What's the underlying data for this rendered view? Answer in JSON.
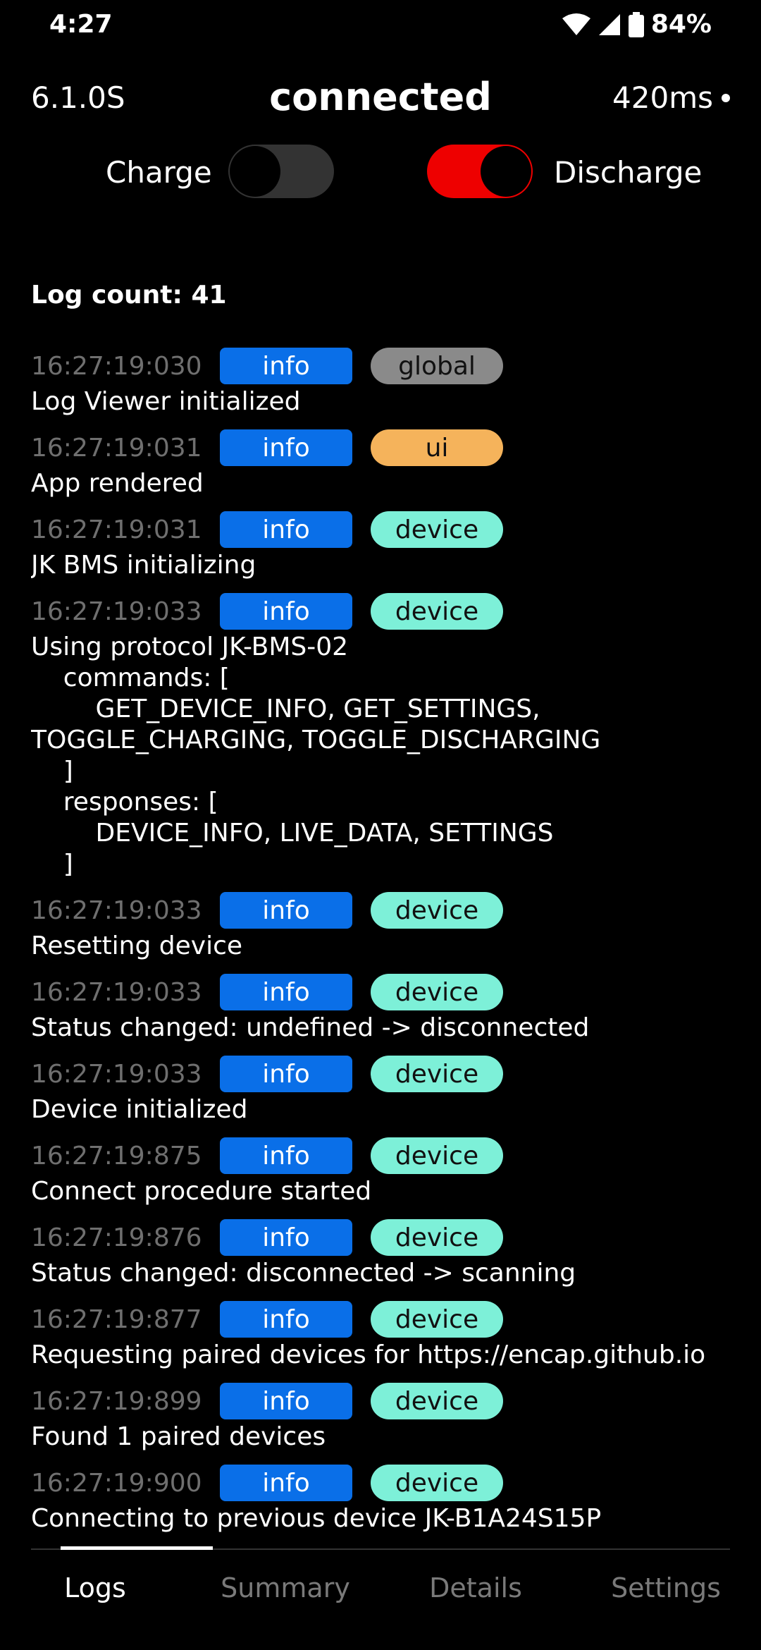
{
  "statusbar": {
    "time": "4:27",
    "battery": "84%",
    "icons": [
      "wifi-icon",
      "signal-icon",
      "battery-icon"
    ]
  },
  "header": {
    "version": "6.1.0S",
    "status": "connected",
    "latency": "420ms"
  },
  "toggles": {
    "charge_label": "Charge",
    "charge_on": false,
    "discharge_label": "Discharge",
    "discharge_on": true,
    "on_color": "#ee0000",
    "off_color": "#333333"
  },
  "log_count_label": "Log count: 41",
  "category_colors": {
    "global": "#8a8a8a",
    "ui": "#f5b35b",
    "device": "#7df0d8"
  },
  "logs": [
    {
      "time": "16:27:19:030",
      "level": "info",
      "category": "global",
      "message": "Log Viewer initialized"
    },
    {
      "time": "16:27:19:031",
      "level": "info",
      "category": "ui",
      "message": "App rendered"
    },
    {
      "time": "16:27:19:031",
      "level": "info",
      "category": "device",
      "message": "JK BMS initializing"
    },
    {
      "time": "16:27:19:033",
      "level": "info",
      "category": "device",
      "message": "Using protocol JK-BMS-02\n    commands: [\n        GET_DEVICE_INFO, GET_SETTINGS,\nTOGGLE_CHARGING, TOGGLE_DISCHARGING\n    ]\n    responses: [\n        DEVICE_INFO, LIVE_DATA, SETTINGS\n    ]"
    },
    {
      "time": "16:27:19:033",
      "level": "info",
      "category": "device",
      "message": "Resetting device"
    },
    {
      "time": "16:27:19:033",
      "level": "info",
      "category": "device",
      "message": "Status changed: undefined -> disconnected"
    },
    {
      "time": "16:27:19:033",
      "level": "info",
      "category": "device",
      "message": "Device initialized"
    },
    {
      "time": "16:27:19:875",
      "level": "info",
      "category": "device",
      "message": "Connect procedure started"
    },
    {
      "time": "16:27:19:876",
      "level": "info",
      "category": "device",
      "message": "Status changed: disconnected -> scanning"
    },
    {
      "time": "16:27:19:877",
      "level": "info",
      "category": "device",
      "message": "Requesting paired devices for https://encap.github.io"
    },
    {
      "time": "16:27:19:899",
      "level": "info",
      "category": "device",
      "message": "Found 1 paired devices"
    },
    {
      "time": "16:27:19:900",
      "level": "info",
      "category": "device",
      "message": "Connecting to previous device JK-B1A24S15P"
    }
  ],
  "tabs": [
    {
      "label": "Logs",
      "active": true
    },
    {
      "label": "Summary",
      "active": false
    },
    {
      "label": "Details",
      "active": false
    },
    {
      "label": "Settings",
      "active": false
    }
  ]
}
